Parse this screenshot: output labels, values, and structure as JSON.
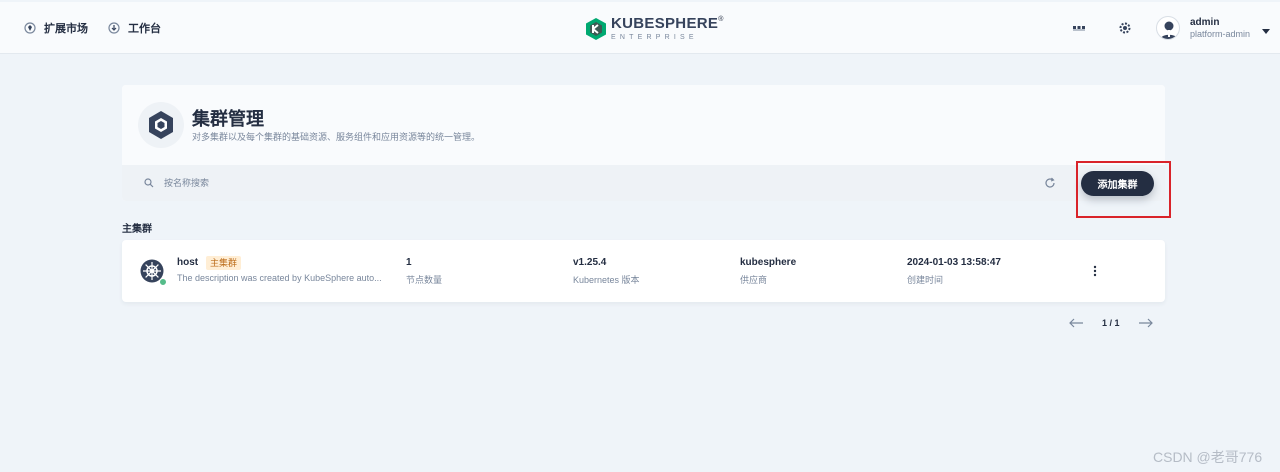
{
  "nav": {
    "marketplace_label": "扩展市场",
    "workbench_label": "工作台",
    "logo_main": "KUBESPHERE",
    "logo_reg": "®",
    "logo_sub": "ENTERPRISE",
    "user_name": "admin",
    "user_role": "platform-admin"
  },
  "header": {
    "title": "集群管理",
    "description": "对多集群以及每个集群的基础资源、服务组件和应用资源等的统一管理。",
    "search_placeholder": "按名称搜索",
    "add_button": "添加集群"
  },
  "section": {
    "title": "主集群"
  },
  "clusters": [
    {
      "name": "host",
      "badge": "主集群",
      "description": "The description was created by KubeSphere auto...",
      "nodes": "1",
      "nodes_label": "节点数量",
      "version": "v1.25.4",
      "version_label": "Kubernetes 版本",
      "provider": "kubesphere",
      "provider_label": "供应商",
      "created": "2024-01-03 13:58:47",
      "created_label": "创建时间",
      "status_color": "#55bc8a"
    }
  ],
  "pagination": {
    "page_info": "1 / 1"
  },
  "watermark": "CSDN @老哥776",
  "colors": {
    "brand_dark": "#242e42",
    "logo_green": "#00a971",
    "highlight": "#d9232a"
  }
}
